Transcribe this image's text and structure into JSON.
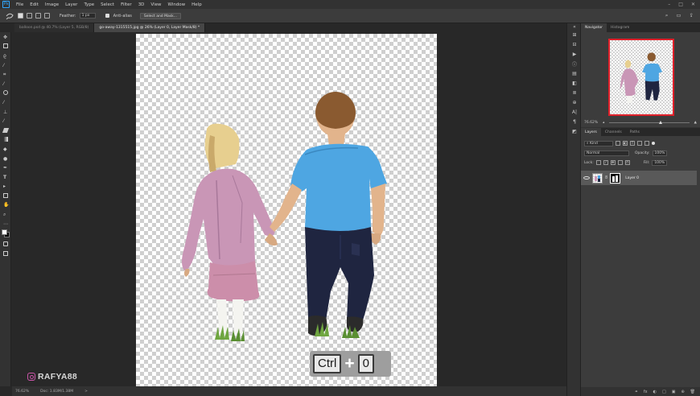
{
  "menubar": {
    "logo": "Ps",
    "items": [
      "File",
      "Edit",
      "Image",
      "Layer",
      "Type",
      "Select",
      "Filter",
      "3D",
      "View",
      "Window",
      "Help"
    ],
    "window_controls": [
      "–",
      "□",
      "✕"
    ]
  },
  "options": {
    "feather_label": "Feather:",
    "feather_value": "1 px",
    "antialias_label": "Anti-alias",
    "select_mask_label": "Select and Mask..."
  },
  "tabs": [
    {
      "label": "balloon.psd @ 40.7% (Layer 5, RGB/8)"
    },
    {
      "label": "go-away-1315515.jpg @ 26% (Layer 0, Layer Mask/8) *"
    }
  ],
  "tool_icons": [
    "move-icon",
    "marquee-icon",
    "lasso-icon",
    "magic-wand-icon",
    "crop-icon",
    "eyedropper-icon",
    "healing-icon",
    "brush-icon",
    "stamp-icon",
    "history-brush-icon",
    "eraser-icon",
    "gradient-icon",
    "blur-icon",
    "dodge-icon",
    "pen-icon",
    "type-icon",
    "path-select-icon",
    "shape-icon",
    "hand-icon",
    "zoom-icon",
    "more-icon"
  ],
  "overlay": {
    "key1": "Ctrl",
    "plus": "+",
    "key2": "0"
  },
  "watermark": {
    "text": "RAFYA88"
  },
  "status": {
    "zoom": "76.62%",
    "doc": "Doc: 1.83M/1.38M",
    "arrow": ">"
  },
  "navigator": {
    "tabs": [
      "Navigator",
      "Histogram"
    ],
    "zoom_value": "76.62%"
  },
  "layers_panel": {
    "tabs": [
      "Layers",
      "Channels",
      "Paths"
    ],
    "kind_label": "Kind",
    "blend_mode": "Normal",
    "opacity_label": "Opacity:",
    "opacity_value": "100%",
    "lock_label": "Lock:",
    "fill_label": "Fill:",
    "fill_value": "100%",
    "layer_name": "Layer 0"
  },
  "footer_icons": [
    "fx",
    "◐",
    "□",
    "▣",
    "⊕",
    "🗑"
  ],
  "colors": {
    "accent": "#31a8ff",
    "nav_frame": "#e0202a",
    "shirt": "#4ea6e2",
    "jacket": "#c896b4"
  }
}
